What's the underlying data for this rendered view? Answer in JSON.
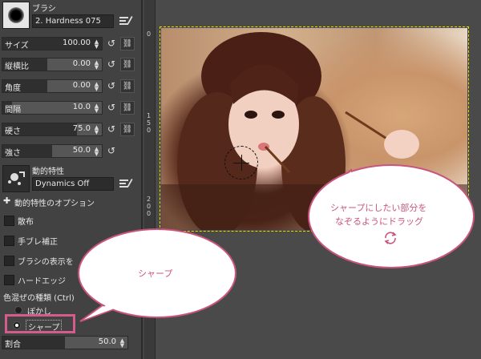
{
  "brush": {
    "title": "ブラシ",
    "name": "2. Hardness 075"
  },
  "options": [
    {
      "label": "サイズ",
      "value": "100.00",
      "fill": 1.0,
      "chain": true
    },
    {
      "label": "縦横比",
      "value": "0.00",
      "fill": 0.45,
      "chain": true
    },
    {
      "label": "角度",
      "value": "0.00",
      "fill": 0.45,
      "chain": true
    },
    {
      "label": "間隔",
      "value": "10.0",
      "fill": 0.1,
      "chain": true
    },
    {
      "label": "硬さ",
      "value": "75.0",
      "fill": 0.75,
      "chain": true
    },
    {
      "label": "強さ",
      "value": "50.0",
      "fill": 0.5,
      "chain": false
    }
  ],
  "dynamics": {
    "title": "動的特性",
    "name": "Dynamics Off",
    "options_label": "動的特性のオプション"
  },
  "checks": [
    {
      "label": "散布"
    },
    {
      "label": "手ブレ補正"
    },
    {
      "label": "ブラシの表示を"
    },
    {
      "label": "ハードエッジ"
    }
  ],
  "blur_type": {
    "label": "色混ぜの種類 (Ctrl)",
    "options": [
      {
        "label": "ぼかし",
        "selected": false
      },
      {
        "label": "シャープ",
        "selected": true
      }
    ]
  },
  "rate": {
    "label": "割合",
    "value": "50.0",
    "fill": 0.5
  },
  "ruler": {
    "marks": [
      "0",
      "1",
      "5",
      "0",
      "2",
      "0",
      "0",
      "2",
      "5",
      "0"
    ]
  },
  "annotations": {
    "canvas_note_line1": "シャープにしたい部分を",
    "canvas_note_line2": "なぞるようにドラッグ",
    "panel_note": "シャープ"
  },
  "colors": {
    "accent": "#c9557f",
    "selection": "#e8e000",
    "highlight": "#d35c8c"
  }
}
